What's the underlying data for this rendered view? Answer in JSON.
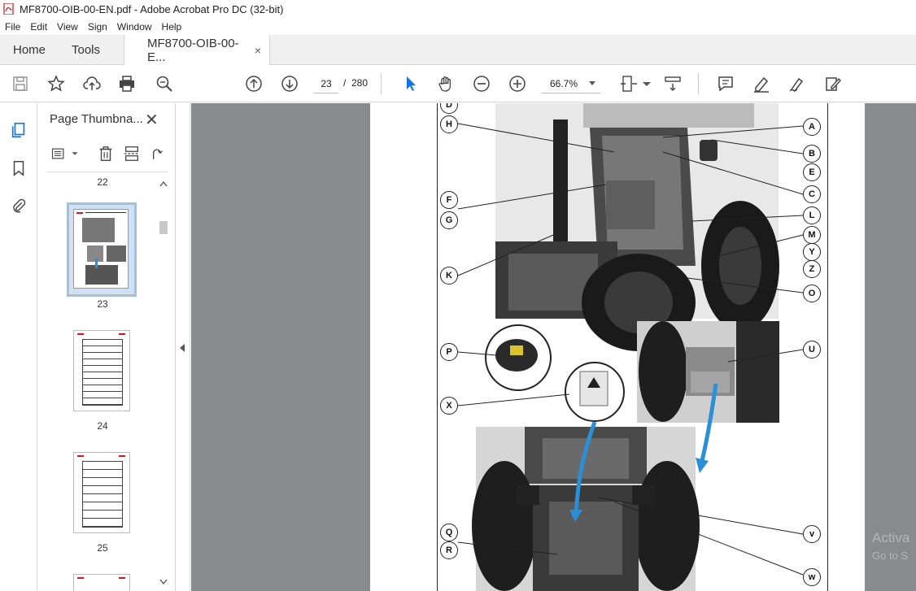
{
  "window": {
    "title": "MF8700-OIB-00-EN.pdf - Adobe Acrobat Pro DC (32-bit)"
  },
  "menu": {
    "items": [
      "File",
      "Edit",
      "View",
      "Sign",
      "Window",
      "Help"
    ]
  },
  "tabs": {
    "home": "Home",
    "tools": "Tools",
    "doc": "MF8700-OIB-00-E...",
    "doc_close": "×"
  },
  "toolbar": {
    "current_page": "23",
    "page_sep": "/",
    "total_pages": "280",
    "zoom": "66.7%"
  },
  "panel": {
    "title": "Page Thumbna...",
    "close": "✕",
    "thumbnails": [
      {
        "label": "22"
      },
      {
        "label": "23",
        "selected": true
      },
      {
        "label": "24"
      },
      {
        "label": "25"
      }
    ]
  },
  "page": {
    "callouts": [
      "D",
      "H",
      "A",
      "B",
      "E",
      "C",
      "F",
      "G",
      "L",
      "M",
      "Y",
      "Z",
      "K",
      "O",
      "P",
      "U",
      "X",
      "Q",
      "R",
      "v",
      "w"
    ]
  },
  "watermark": {
    "line1": "Activa",
    "line2": "Go to S"
  },
  "colors": {
    "accent": "#1473e6",
    "arrow_blue": "#2a8fd6",
    "pdf_red": "#d4161c"
  }
}
